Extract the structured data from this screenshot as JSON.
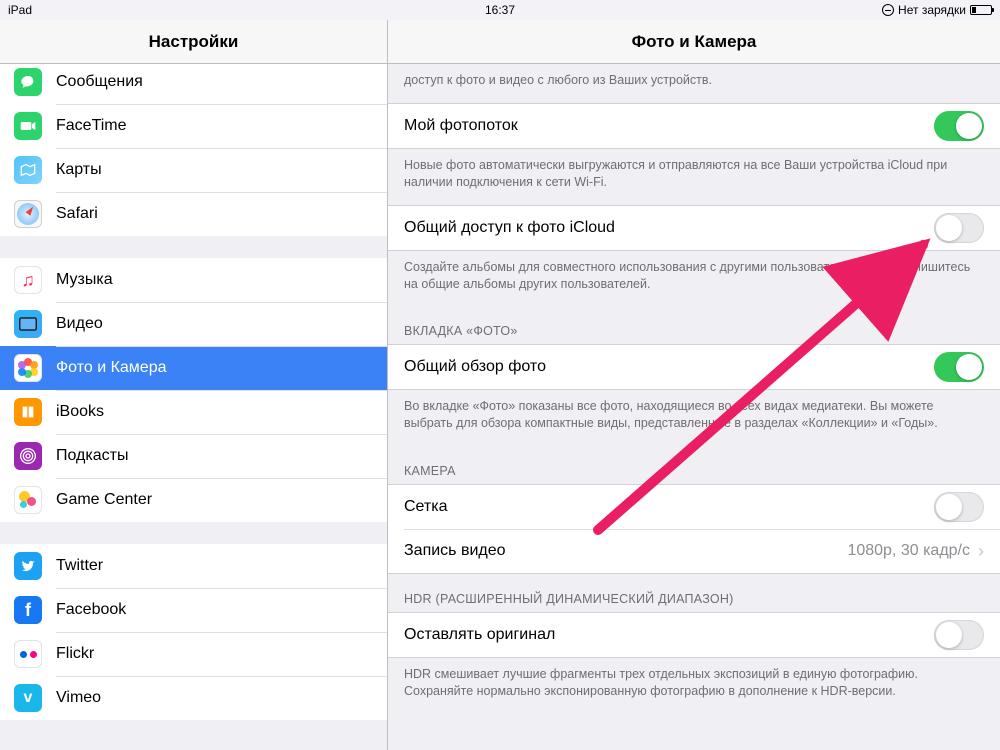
{
  "status": {
    "device": "iPad",
    "time": "16:37",
    "charge": "Нет зарядки"
  },
  "left_title": "Настройки",
  "right_title": "Фото и Камера",
  "sidebar": {
    "g1": [
      {
        "id": "messages",
        "label": "Сообщения"
      },
      {
        "id": "facetime",
        "label": "FaceTime"
      },
      {
        "id": "maps",
        "label": "Карты"
      },
      {
        "id": "safari",
        "label": "Safari"
      }
    ],
    "g2": [
      {
        "id": "music",
        "label": "Музыка"
      },
      {
        "id": "video",
        "label": "Видео"
      },
      {
        "id": "photos",
        "label": "Фото и Камера"
      },
      {
        "id": "ibooks",
        "label": "iBooks"
      },
      {
        "id": "podcasts",
        "label": "Подкасты"
      },
      {
        "id": "gamecenter",
        "label": "Game Center"
      }
    ],
    "g3": [
      {
        "id": "twitter",
        "label": "Twitter"
      },
      {
        "id": "facebook",
        "label": "Facebook"
      },
      {
        "id": "flickr",
        "label": "Flickr"
      },
      {
        "id": "vimeo",
        "label": "Vimeo"
      }
    ]
  },
  "content": {
    "icloud_library_footer": "доступ к фото и видео с любого из Ваших устройств.",
    "photostream": {
      "label": "Мой фотопоток",
      "footer": "Новые фото автоматически выгружаются и отправляются на все Ваши устройства iCloud при наличии подключения к сети Wi-Fi.",
      "on": true
    },
    "sharing": {
      "label": "Общий доступ к фото iCloud",
      "footer": "Создайте альбомы для совместного использования с другими пользователями или подпишитесь на общие альбомы других пользователей.",
      "on": false
    },
    "phototab": {
      "header": "ВКЛАДКА «ФОТО»",
      "label": "Общий обзор фото",
      "footer": "Во вкладке «Фото» показаны все фото, находящиеся во всех видах медиатеки. Вы можете выбрать для обзора компактные виды, представленные в разделах «Коллекции» и «Годы».",
      "on": true
    },
    "camera": {
      "header": "КАМЕРА",
      "grid_label": "Сетка",
      "grid_on": false,
      "record_label": "Запись видео",
      "record_value": "1080p, 30 кадр/с"
    },
    "hdr": {
      "header": "HDR (РАСШИРЕННЫЙ ДИНАМИЧЕСКИЙ ДИАПАЗОН)",
      "label": "Оставлять оригинал",
      "footer": "HDR смешивает лучшие фрагменты трех отдельных экспозиций в единую фотографию. Сохраняйте нормально экспонированную фотографию в дополнение к HDR-версии.",
      "on": false
    }
  }
}
